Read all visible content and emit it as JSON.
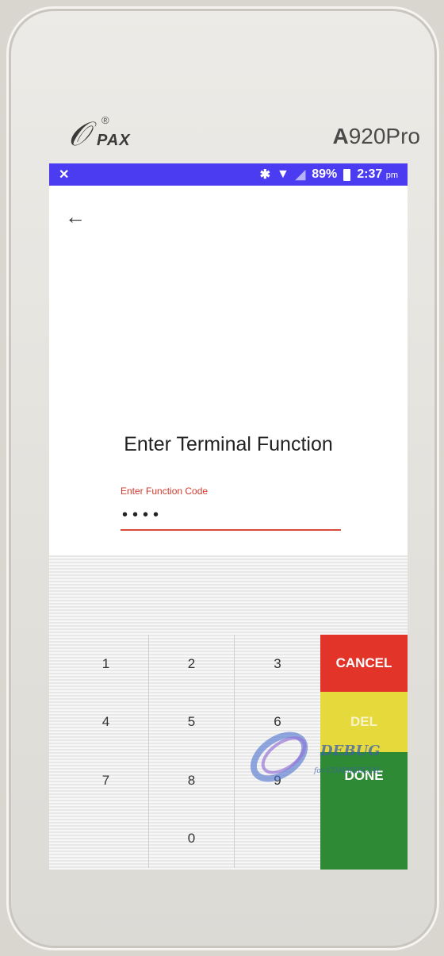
{
  "device": {
    "brand": "PAX",
    "brand_reg": "®",
    "model_bold": "A",
    "model_rest": "920Pro"
  },
  "status_bar": {
    "left_icon": "✕",
    "bluetooth_icon": "bluetooth-icon",
    "wifi_icon": "wifi-icon",
    "signal_icon": "no-signal-icon",
    "battery_percent": "89%",
    "time": "2:37",
    "ampm": "pm",
    "color": "#4b3cf2"
  },
  "header": {
    "back_icon": "←"
  },
  "main": {
    "title": "Enter Terminal Function",
    "field_label": "Enter Function Code",
    "field_value": "••••",
    "accent": "#d33a2c"
  },
  "keypad": {
    "keys": [
      "1",
      "2",
      "3",
      "4",
      "5",
      "6",
      "7",
      "8",
      "9",
      "",
      "0",
      ""
    ],
    "cancel": "CANCEL",
    "del": "DEL",
    "done": "DONE",
    "colors": {
      "cancel": "#e3342a",
      "del": "#e5d93c",
      "done": "#2e8a35"
    }
  },
  "watermark": {
    "text": "DEBUG",
    "subtext": "for COMMERCIAL"
  }
}
